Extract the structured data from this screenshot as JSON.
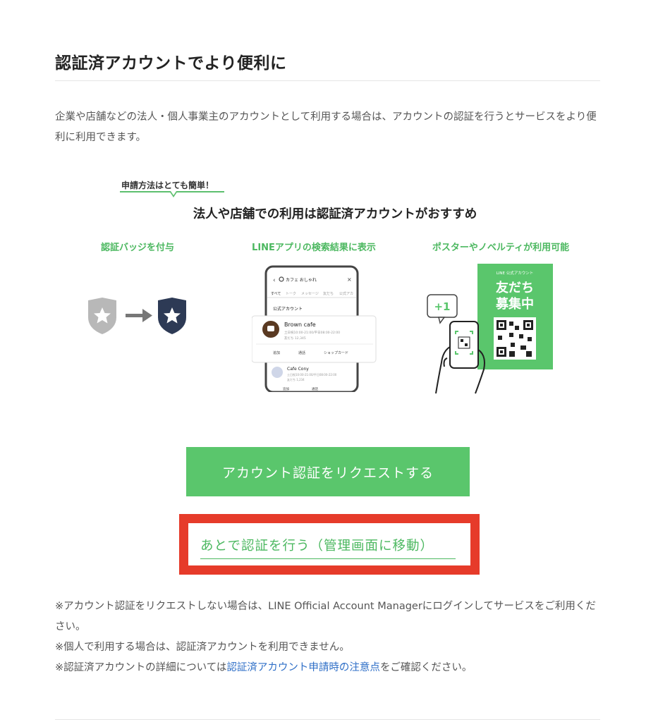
{
  "page": {
    "title": "認証済アカウントでより便利に",
    "intro": "企業や店舗などの法人・個人事業主のアカウントとして利用する場合は、アカウントの認証を行うとサービスをより便利に利用できます。"
  },
  "banner": {
    "tagline": "申請方法はとても簡単！",
    "headline": "法人や店舗での利用は認証済アカウントがおすすめ",
    "features": [
      "認証バッジを付与",
      "LINEアプリの検索結果に表示",
      "ポスターやノベルティが利用可能"
    ],
    "phone": {
      "search_query": "カフェ おしゃれ",
      "tabs": [
        "すべて",
        "トーク",
        "メッセージ",
        "友だち",
        "公式アカ"
      ],
      "section_label": "公式アカウント",
      "result1_name": "Brown cafe",
      "result1_hours": "土日祝10:00-21:00/平日08:00-22:00",
      "result1_friends": "友だち 12,345",
      "action_add": "追加",
      "action_call": "通話",
      "action_shop": "ショップカード",
      "result2_name": "Cafe Cony",
      "result2_hours": "土日祝10:00-21:00/平日08:00-22:00",
      "result2_friends": "友だち 1,234",
      "result2_add": "追加",
      "result2_call": "通話"
    },
    "poster": {
      "header": "LINE 公式アカウント",
      "line1": "友だち",
      "line2": "募集中",
      "bubble": "+1"
    }
  },
  "actions": {
    "request_label": "アカウント認証をリクエストする",
    "later_label": "あとで認証を行う（管理画面に移動）"
  },
  "notes": {
    "line1": "※アカウント認証をリクエストしない場合は、LINE Official Account Managerにログインしてサービスをご利用ください。",
    "line2": "※個人で利用する場合は、認証済アカウントを利用できません。",
    "line3_prefix": "※認証済アカウントの詳細については",
    "line3_link": "認証済アカウント申請時の注意点",
    "line3_suffix": "をご確認ください。"
  },
  "colors": {
    "accent_green": "#5ac66c",
    "highlight_red": "#e63b2a",
    "link_blue": "#2f6fc7"
  }
}
